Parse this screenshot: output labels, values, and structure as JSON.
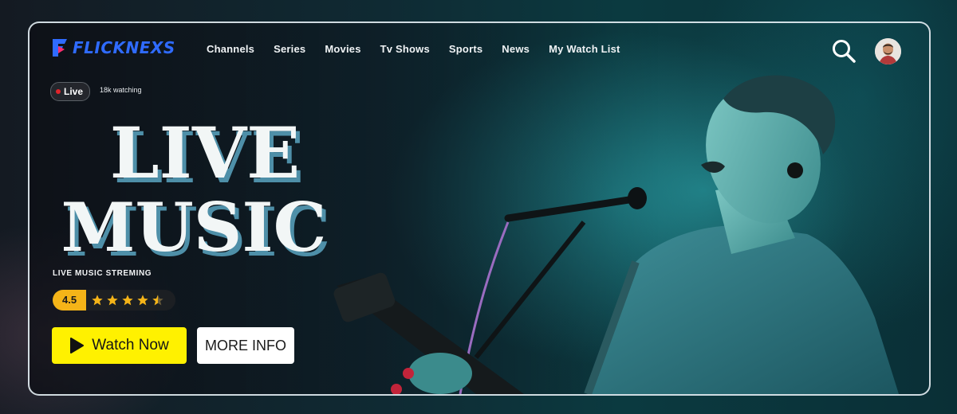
{
  "brand": {
    "name": "FLICKNEXS",
    "accent": "#2f6bff"
  },
  "nav": {
    "items": [
      {
        "label": "Channels"
      },
      {
        "label": "Series"
      },
      {
        "label": "Movies"
      },
      {
        "label": "Tv Shows"
      },
      {
        "label": "Sports"
      },
      {
        "label": "News"
      },
      {
        "label": "My Watch List"
      }
    ],
    "search_icon": "search-icon",
    "avatar_icon": "user-avatar"
  },
  "hero": {
    "live_label": "Live",
    "watching": "18k watching",
    "title_line1": "LIVE",
    "title_line2": "MUSIC",
    "subtitle": "LIVE MUSIC STREMING",
    "rating": "4.5",
    "rating_stars": 4.5,
    "watch_label": "Watch Now",
    "info_label": "MORE INFO"
  },
  "colors": {
    "watch_button": "#fff100",
    "rating_badge": "#f5b418",
    "star": "#f5b418",
    "live_dot": "#e0242b"
  }
}
